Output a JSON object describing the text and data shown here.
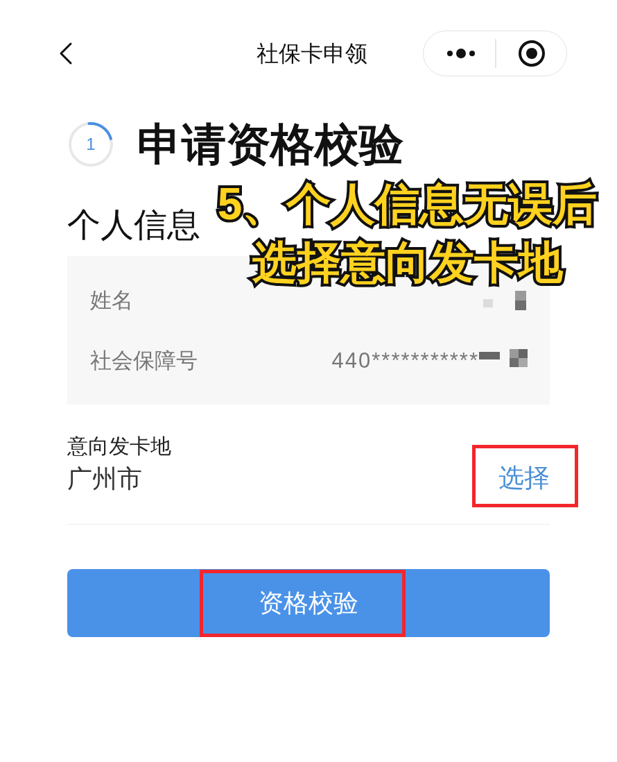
{
  "nav_bar": {
    "title": "社保卡申领"
  },
  "step": {
    "number": "1",
    "level": 0.22,
    "title": "申请资格校验"
  },
  "section_title": "个人信息",
  "info_card": {
    "rows": [
      {
        "label": "姓名",
        "value_redacted": true
      },
      {
        "label": "社会保障号",
        "value": "440***********",
        "value_redacted": true
      }
    ]
  },
  "issuing_place": {
    "label": "意向发卡地",
    "value": "广州市",
    "select_button": {
      "label": "选择",
      "highlighted": true
    }
  },
  "submit_button": {
    "label": "资格校验",
    "highlighted": true
  },
  "annotation": {
    "lines": [
      "5、个人信息无误后",
      "选择意向发卡地"
    ]
  }
}
